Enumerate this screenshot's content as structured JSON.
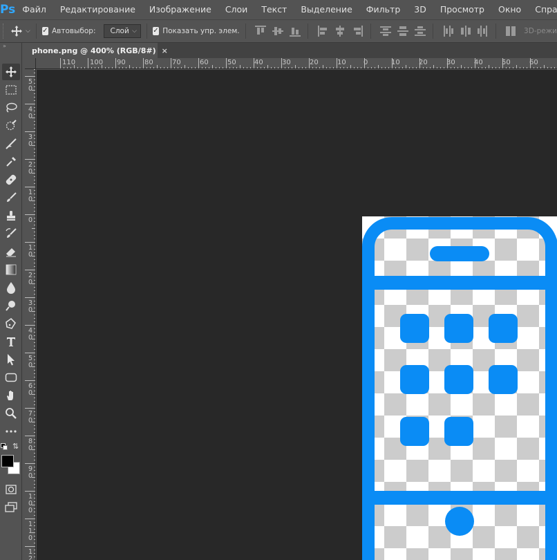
{
  "app": {
    "logo": "Ps"
  },
  "menu": [
    "Файл",
    "Редактирование",
    "Изображение",
    "Слои",
    "Текст",
    "Выделение",
    "Фильтр",
    "3D",
    "Просмотр",
    "Окно",
    "Справка"
  ],
  "options": {
    "autoselect_label": "Автовыбор:",
    "autoselect_value": "Слой",
    "show_transform_label": "Показать упр. элем.",
    "mode_3d_label": "3D-режи"
  },
  "document": {
    "tab_title": "phone.png @ 400% (RGB/8#)",
    "close_glyph": "×"
  },
  "ruler": {
    "top_labels": [
      "110",
      "100",
      "90",
      "80",
      "70",
      "60",
      "50",
      "40",
      "30",
      "20",
      "10",
      "0",
      "10",
      "20",
      "30",
      "40",
      "50",
      "60"
    ],
    "left_labels": [
      "5\n0",
      "4\n0",
      "3\n0",
      "2\n0",
      "1\n0",
      "0",
      "1\n0",
      "2\n0",
      "3\n0",
      "4\n0",
      "5\n0",
      "6\n0",
      "7\n0",
      "8\n0",
      "9\n0",
      "1\n0\n0",
      "1\n1\n0",
      "1\n2"
    ]
  },
  "colors": {
    "accent": "#0a8cf5",
    "canvas_bg": "#282828",
    "ui_bg": "#535353",
    "foreground_swatch": "#000000",
    "background_swatch": "#ffffff"
  },
  "icons": {
    "tools": [
      "move-icon",
      "marquee-icon",
      "lasso-icon",
      "quick-select-icon",
      "crop-icon",
      "eyedropper-icon",
      "healing-icon",
      "brush-icon",
      "stamp-icon",
      "history-brush-icon",
      "eraser-icon",
      "gradient-icon",
      "blur-icon",
      "dodge-icon",
      "pen-icon",
      "type-icon",
      "path-select-icon",
      "shape-icon",
      "hand-icon",
      "zoom-icon",
      "more-icon",
      "quick-mask-icon",
      "screen-mode-icon"
    ]
  }
}
